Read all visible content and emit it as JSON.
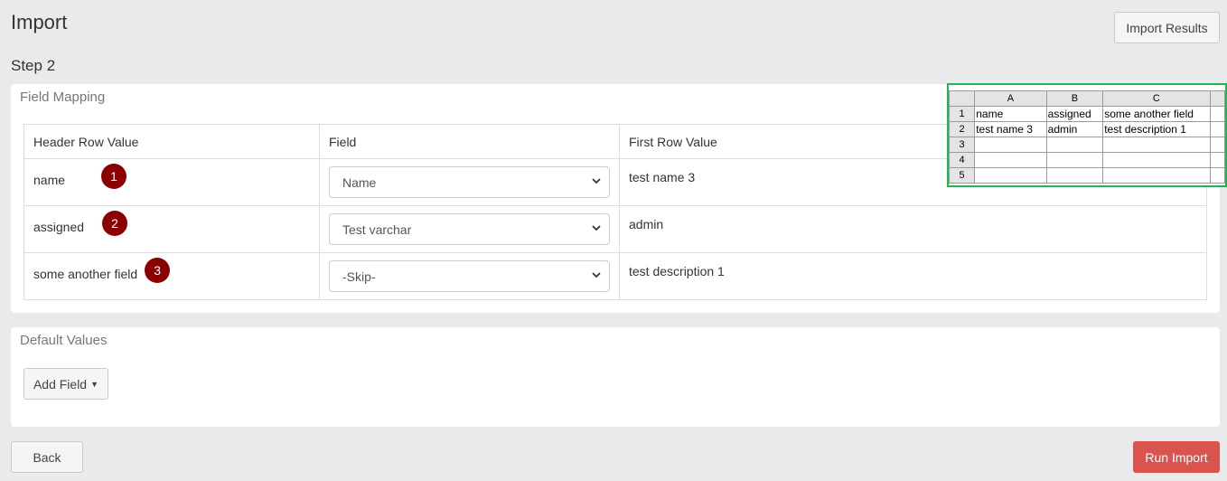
{
  "header": {
    "title": "Import",
    "import_results_label": "Import Results",
    "step_title": "Step 2"
  },
  "field_mapping": {
    "title": "Field Mapping",
    "columns": [
      "Header Row Value",
      "Field",
      "First Row Value"
    ],
    "rows": [
      {
        "header": "name",
        "badge": "1",
        "field": "Name",
        "first_value": "test name 3"
      },
      {
        "header": "assigned",
        "badge": "2",
        "field": "Test varchar",
        "first_value": "admin"
      },
      {
        "header": "some another field",
        "badge": "3",
        "field": "-Skip-",
        "first_value": "test description 1"
      }
    ]
  },
  "default_values": {
    "title": "Default Values",
    "add_field_label": "Add Field"
  },
  "footer": {
    "back_label": "Back",
    "run_import_label": "Run Import"
  },
  "spreadsheet": {
    "columns": [
      "A",
      "B",
      "C",
      ""
    ],
    "rows": [
      {
        "num": "1",
        "cells": [
          "name",
          "assigned",
          "some another field",
          ""
        ]
      },
      {
        "num": "2",
        "cells": [
          "test name 3",
          "admin",
          "test description 1",
          ""
        ]
      },
      {
        "num": "3",
        "cells": [
          "",
          "",
          "",
          ""
        ]
      },
      {
        "num": "4",
        "cells": [
          "",
          "",
          "",
          ""
        ]
      },
      {
        "num": "5",
        "cells": [
          "",
          "",
          "",
          ""
        ]
      }
    ]
  },
  "colors": {
    "run_import": "#d9534f",
    "badge": "#8b0000",
    "sheet_border": "#22b557"
  }
}
